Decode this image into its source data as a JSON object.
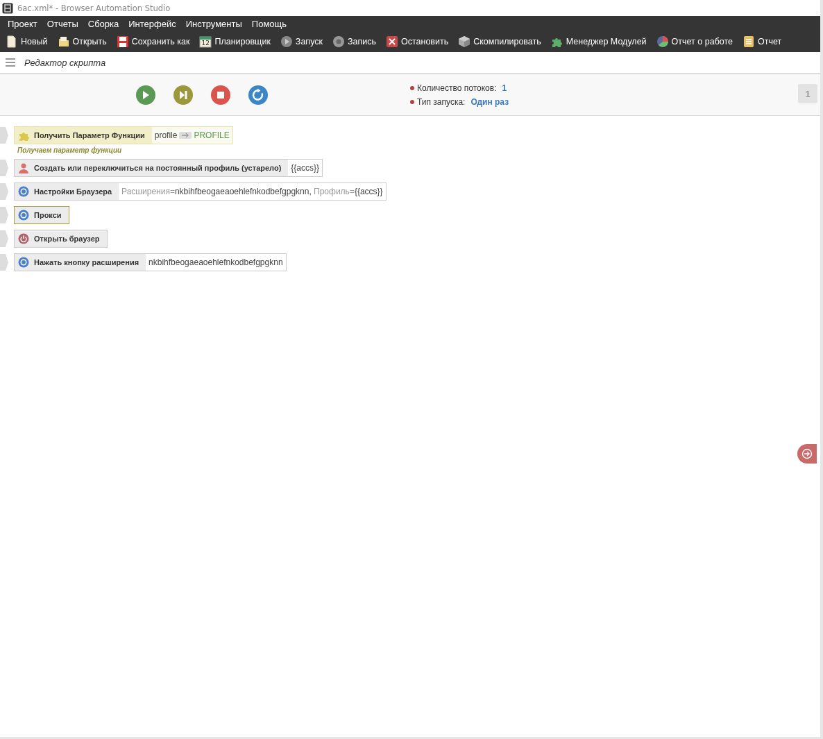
{
  "window": {
    "title": "6ac.xml* - Browser Automation Studio"
  },
  "menu": [
    "Проект",
    "Отчеты",
    "Сборка",
    "Интерфейс",
    "Инструменты",
    "Помощь"
  ],
  "toolbar": [
    {
      "kind": "new",
      "label": "Новый"
    },
    {
      "kind": "open",
      "label": "Открыть"
    },
    {
      "kind": "save",
      "label": "Сохранить как"
    },
    {
      "kind": "scheduler",
      "label": "Планировщик",
      "icon_text": "12"
    },
    {
      "kind": "run",
      "label": "Запуск"
    },
    {
      "kind": "record",
      "label": "Запись"
    },
    {
      "kind": "stop",
      "label": "Остановить"
    },
    {
      "kind": "compile",
      "label": "Скомпилировать"
    },
    {
      "kind": "modules",
      "label": "Менеджер Модулей"
    },
    {
      "kind": "report",
      "label": "Отчет о работе"
    },
    {
      "kind": "log",
      "label": "Отчет"
    }
  ],
  "editor": {
    "title": "Редактор скрипта"
  },
  "run_panel": {
    "controls": [
      {
        "kind": "play"
      },
      {
        "kind": "step"
      },
      {
        "kind": "stop"
      },
      {
        "kind": "restart"
      }
    ],
    "info": [
      {
        "label": "Количество потоков:",
        "value": "1"
      },
      {
        "label": "Тип запуска:",
        "value": "Один раз"
      }
    ],
    "thread_badge": "1"
  },
  "actions": [
    {
      "kind": "function",
      "name": "Получить Параметр Функции",
      "selected": false,
      "params": [
        {
          "kind": "value",
          "text": "profile"
        },
        {
          "kind": "output",
          "text": "PROFILE"
        }
      ],
      "comment": "Получаем параметр функции"
    },
    {
      "kind": "profile",
      "name": "Создать или переключиться на постоянный профиль (устарело)",
      "selected": false,
      "params": [
        {
          "kind": "value",
          "text": "{{accs}}"
        }
      ]
    },
    {
      "kind": "browser",
      "name": "Настройки Браузера",
      "selected": false,
      "params": [
        {
          "kind": "key",
          "text": "Расширения="
        },
        {
          "kind": "value",
          "text": "nkbihfbeogaeaoehlefnkodbefgpgknn,"
        },
        {
          "kind": "key",
          "text": " Профиль="
        },
        {
          "kind": "value",
          "text": "{{accs}}"
        }
      ]
    },
    {
      "kind": "browser",
      "name": "Прокси",
      "selected": true
    },
    {
      "kind": "power",
      "name": "Открыть браузер",
      "selected": false
    },
    {
      "kind": "browser",
      "name": "Нажать кнопку расширения",
      "selected": false,
      "params": [
        {
          "kind": "value",
          "text": "nkbihfbeogaeaoehlefnkodbefgpgknn"
        }
      ]
    }
  ]
}
